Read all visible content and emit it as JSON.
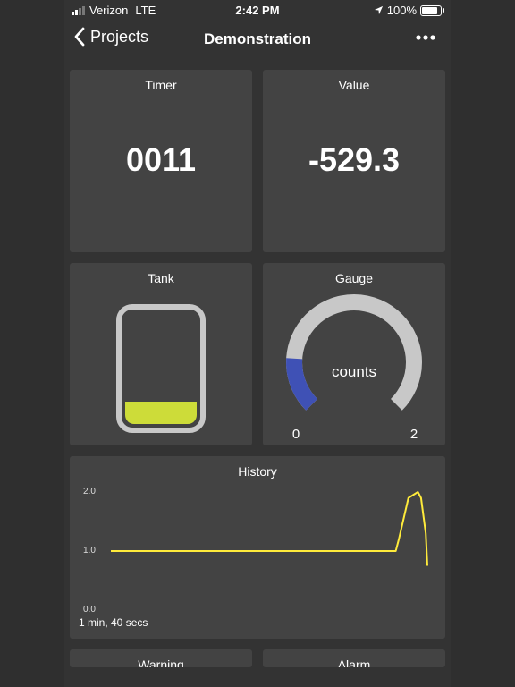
{
  "status_bar": {
    "carrier": "Verizon",
    "network": "LTE",
    "time": "2:42 PM",
    "battery": "100%",
    "battery_level": 1.0,
    "signal_bars": 2
  },
  "nav": {
    "back_label": "Projects",
    "title": "Demonstration",
    "more_icon": "ellipsis-icon"
  },
  "tiles": {
    "timer": {
      "title": "Timer",
      "value": "0011"
    },
    "value": {
      "title": "Value",
      "value": "-529.3"
    },
    "tank": {
      "title": "Tank",
      "level": 0.2,
      "fill_color": "#cddc39"
    },
    "gauge": {
      "title": "Gauge",
      "label": "counts",
      "min": "0",
      "max": "2",
      "value": 0.36,
      "range": [
        0,
        2
      ],
      "value_color": "#3f51b5",
      "track_color": "#c8c8c8"
    },
    "history": {
      "title": "History",
      "y_ticks": [
        "2.0",
        "1.0",
        "0.0"
      ],
      "time_window": "1 min, 40 secs",
      "line_color": "#ffeb3b"
    },
    "warning": {
      "title": "Warning"
    },
    "alarm": {
      "title": "Alarm"
    }
  },
  "chart_data": {
    "type": "line",
    "title": "History",
    "ylim": [
      0,
      2
    ],
    "x": [
      0,
      50,
      90,
      91,
      94,
      97,
      98,
      99.5,
      100
    ],
    "series": [
      {
        "values": [
          1.0,
          1.0,
          1.0,
          1.2,
          1.9,
          2.0,
          1.9,
          1.3,
          0.75
        ]
      }
    ]
  }
}
